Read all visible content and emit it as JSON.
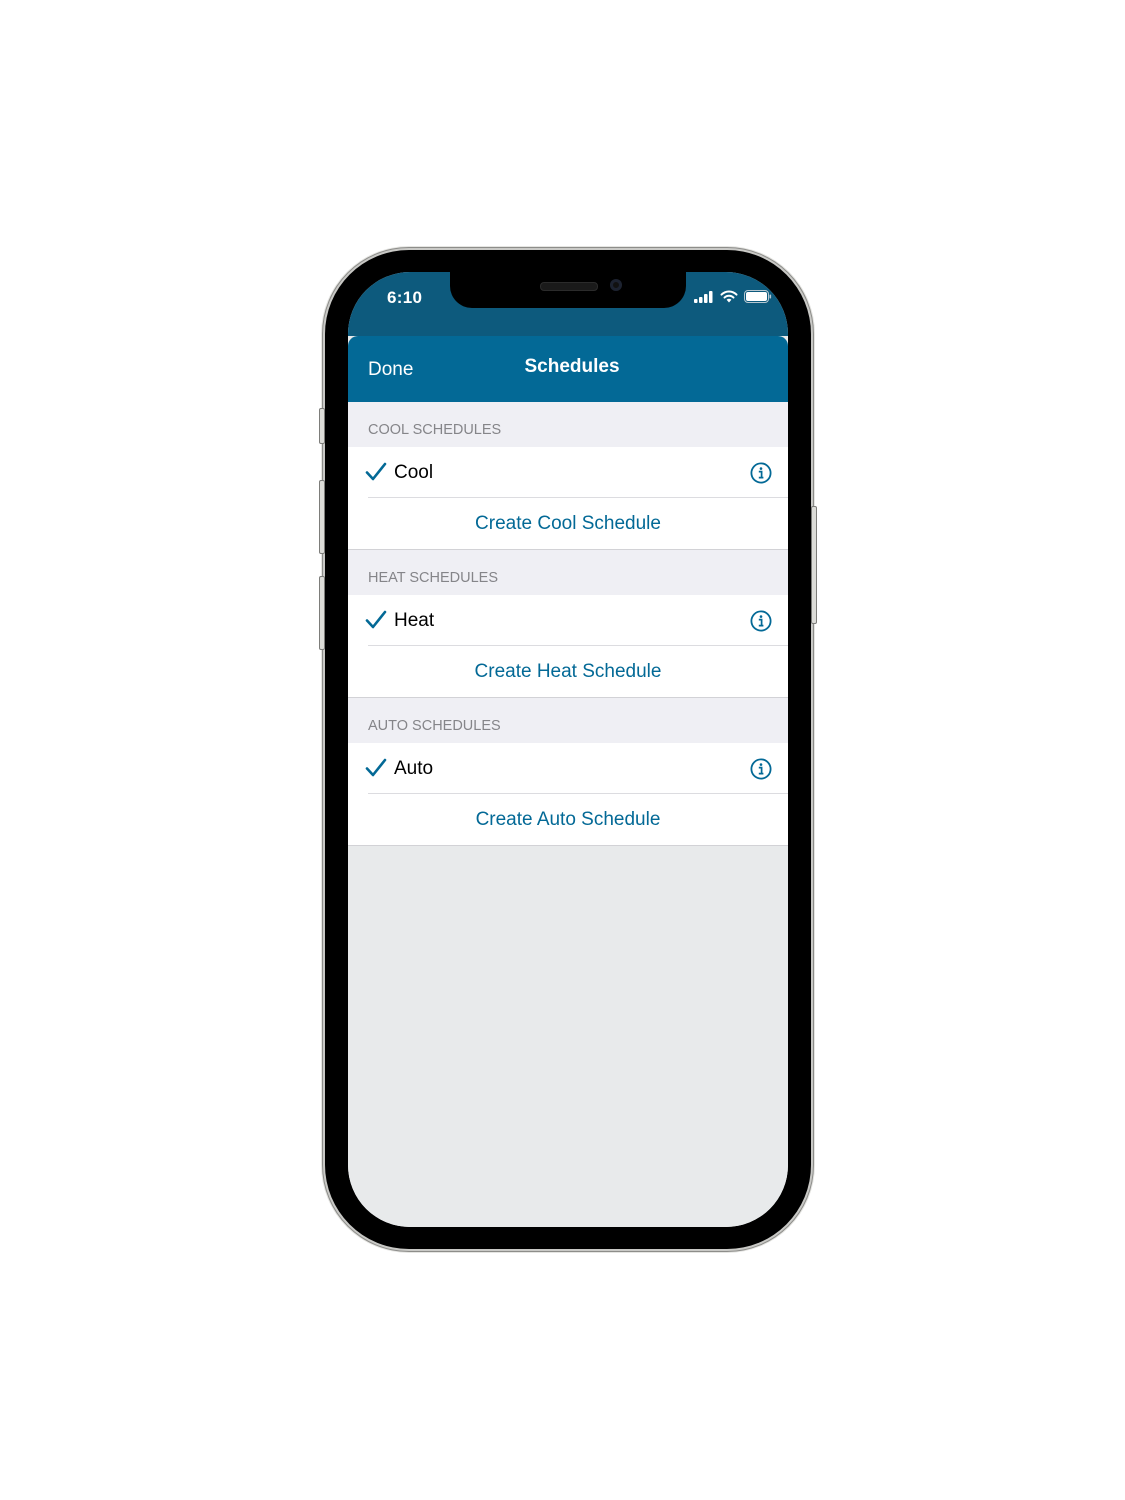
{
  "status_bar": {
    "time": "6:10",
    "icons": [
      "cellular-signal-icon",
      "wifi-icon",
      "battery-icon"
    ]
  },
  "navbar": {
    "done_label": "Done",
    "title": "Schedules"
  },
  "sections": [
    {
      "header": "COOL SCHEDULES",
      "item": {
        "label": "Cool",
        "checked": true,
        "info_icon": "info-circle-icon"
      },
      "create_label": "Create Cool Schedule"
    },
    {
      "header": "HEAT SCHEDULES",
      "item": {
        "label": "Heat",
        "checked": true,
        "info_icon": "info-circle-icon"
      },
      "create_label": "Create Heat Schedule"
    },
    {
      "header": "AUTO SCHEDULES",
      "item": {
        "label": "Auto",
        "checked": true,
        "info_icon": "info-circle-icon"
      },
      "create_label": "Create Auto Schedule"
    }
  ],
  "colors": {
    "brand_blue": "#036996",
    "status_bar_blue": "#0d5a7d",
    "section_header_bg": "#efeff4",
    "section_header_text": "#858589",
    "empty_area_bg": "#e8eaeb"
  }
}
